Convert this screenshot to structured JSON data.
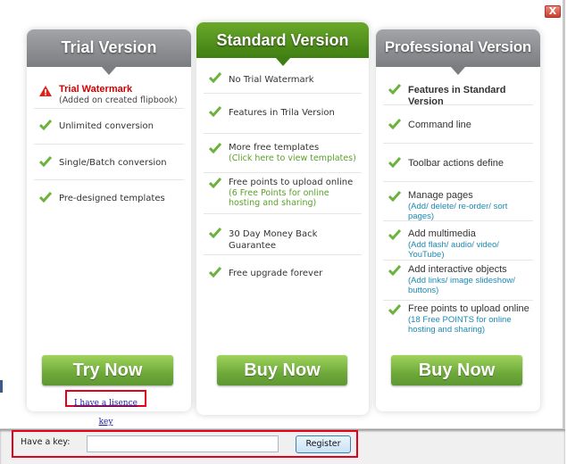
{
  "window": {
    "close_label": "X"
  },
  "plans": {
    "trial": {
      "title": "Trial Version",
      "features": [
        {
          "text": "Trial Watermark",
          "sub": "(Added on created flipbook)",
          "icon": "warning-icon"
        },
        {
          "text": "Unlimited conversion",
          "icon": "check-icon"
        },
        {
          "text": "Single/Batch conversion",
          "icon": "check-icon"
        },
        {
          "text": "Pre-designed templates",
          "icon": "check-icon"
        }
      ],
      "cta_label": "Try Now",
      "license_link": "I have a lisence key"
    },
    "standard": {
      "title": "Standard Version",
      "features": [
        {
          "text": "No Trial Watermark",
          "icon": "check-icon"
        },
        {
          "text": "Features in Trila Version",
          "icon": "check-icon"
        },
        {
          "text": "More free templates",
          "sub": "(Click here to view templates)",
          "icon": "check-icon"
        },
        {
          "text": "Free points to upload online",
          "sub": "(6 Free Points for online hosting and sharing)",
          "icon": "check-icon"
        },
        {
          "text": "30 Day Money Back Guarantee",
          "icon": "check-icon"
        },
        {
          "text": "Free upgrade forever",
          "icon": "check-icon"
        }
      ],
      "cta_label": "Buy Now"
    },
    "professional": {
      "title": "Professional Version",
      "features": [
        {
          "text": "Features in Standard Version",
          "icon": "check-icon"
        },
        {
          "text": "Command line",
          "icon": "check-icon"
        },
        {
          "text": "Toolbar actions define",
          "icon": "check-icon"
        },
        {
          "text": "Manage pages",
          "sub": "(Add/ delete/ re-order/ sort pages)",
          "icon": "check-icon"
        },
        {
          "text": "Add  multimedia",
          "sub": "(Add flash/ audio/ video/ YouTube)",
          "icon": "check-icon"
        },
        {
          "text": "Add interactive objects",
          "sub": "(Add links/ image slideshow/ buttons)",
          "icon": "check-icon"
        },
        {
          "text": "Free points to upload online",
          "sub": "(18 Free POINTS for online hosting and sharing)",
          "icon": "check-icon"
        }
      ],
      "cta_label": "Buy Now"
    }
  },
  "footer": {
    "key_label": "Have a key:",
    "key_value": "",
    "register_label": "Register"
  },
  "colors": {
    "accent_green": "#5f9732",
    "header_gray": "#7b7d81",
    "header_green": "#3f7e12",
    "warning_red": "#d40000",
    "highlight_red": "#e3001b",
    "link_blue": "#1a8ab5"
  }
}
